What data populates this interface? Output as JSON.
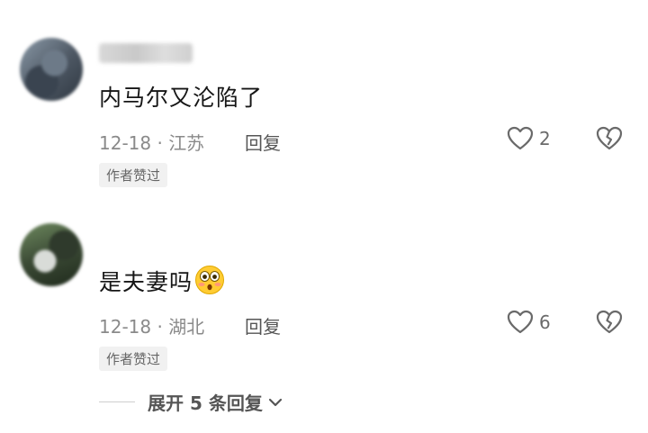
{
  "comments": [
    {
      "content": "内马尔又沦陷了",
      "meta": "12-18 · 江苏",
      "reply_label": "回复",
      "likes": "2",
      "badge": "作者赞过",
      "avatar_icon": "user-avatar",
      "like_icon": "heart-outline-icon",
      "dislike_icon": "broken-heart-icon"
    },
    {
      "content": "是夫妻吗",
      "emoji": "flushed-face-emoji",
      "meta": "12-18 · 湖北",
      "reply_label": "回复",
      "likes": "6",
      "badge": "作者赞过",
      "avatar_icon": "user-avatar",
      "like_icon": "heart-outline-icon",
      "dislike_icon": "broken-heart-icon"
    }
  ],
  "expand_replies": {
    "label": "展开 5 条回复",
    "icon": "chevron-down-icon"
  },
  "colors": {
    "text_primary": "#161616",
    "text_meta": "#8a8a8a",
    "badge_bg": "#f1f1f1"
  }
}
